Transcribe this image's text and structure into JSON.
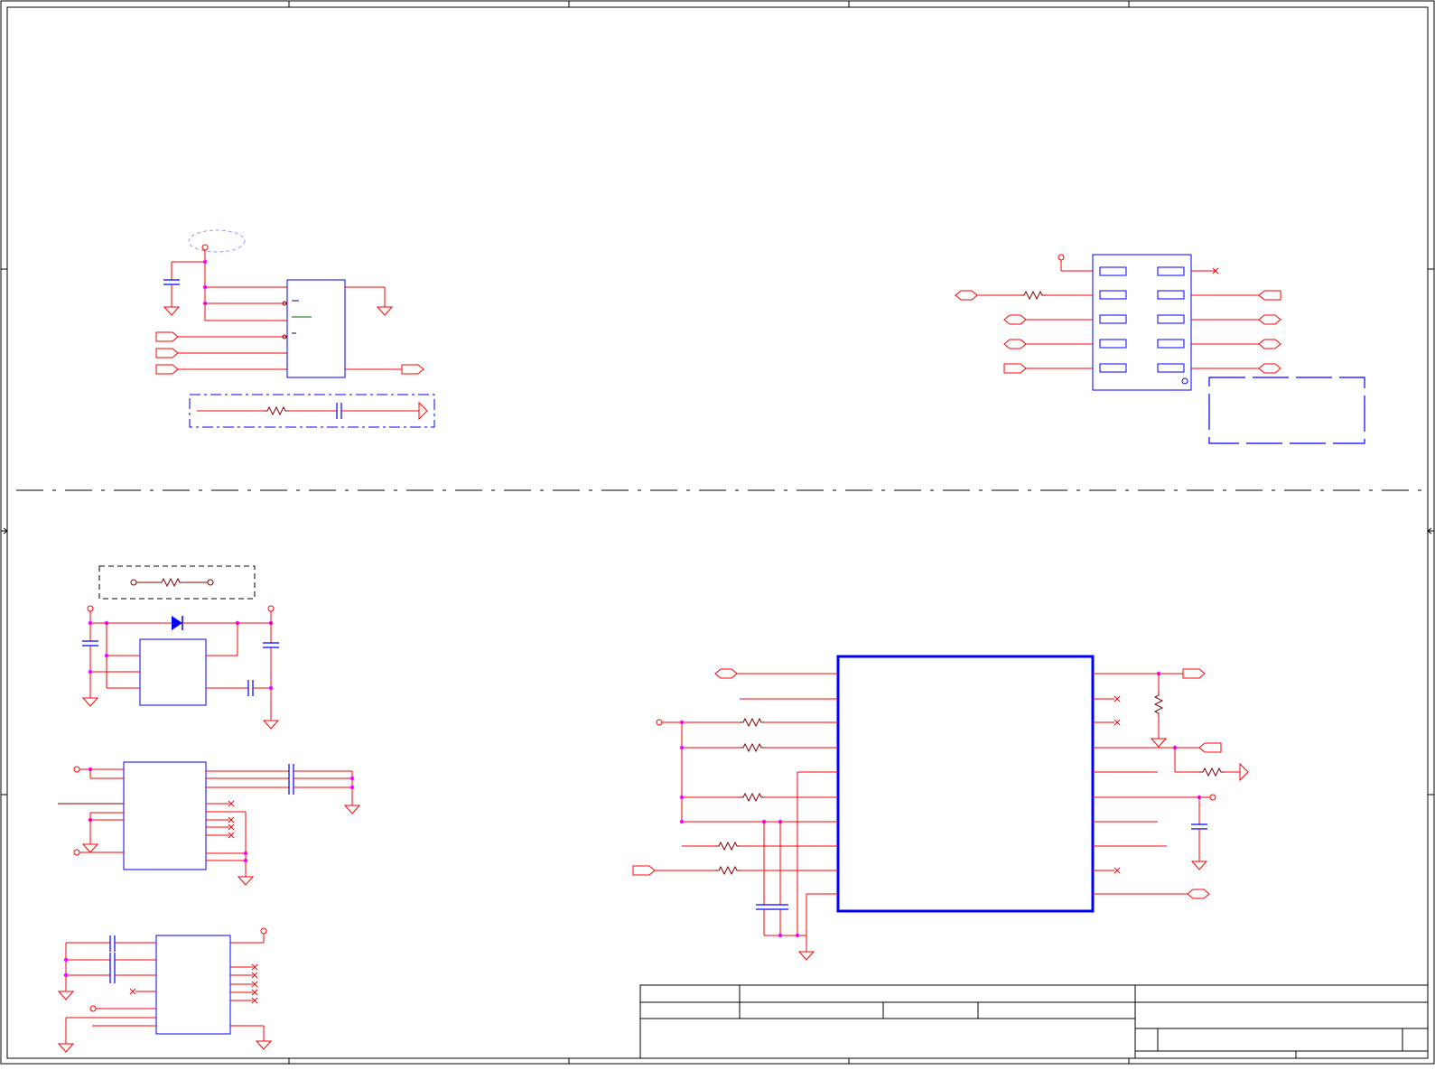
{
  "sheet": {
    "title_block": {
      "rows": [
        "",
        "",
        ""
      ],
      "sheet_text": ""
    }
  },
  "colors": {
    "wire": "#ff0000",
    "body": "#0000ff",
    "junction": "#ff00ff",
    "border": "#000000",
    "note_box": "#0000ff",
    "dashed_note": "#000000",
    "component_net": "#8b0000"
  },
  "icons": {
    "ground": "ground-symbol",
    "power": "power-port-circle",
    "port": "net-port-arrow",
    "no_connect": "no-connect-x",
    "resistor": "resistor-zigzag",
    "capacitor": "capacitor-plates",
    "diode": "diode-triangle"
  }
}
